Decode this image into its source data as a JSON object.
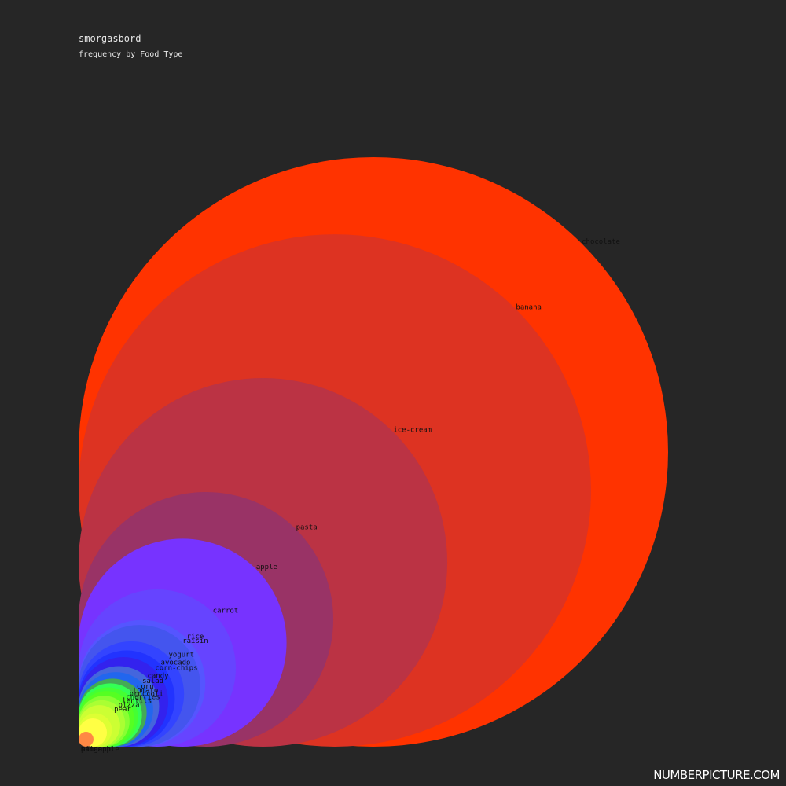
{
  "chart_data": {
    "type": "bubble",
    "title": "smorgasbord",
    "subtitle": "frequency by Food Type",
    "categories": [
      "chocolate",
      "banana",
      "ice-cream",
      "pasta",
      "apple",
      "carrot",
      "rice",
      "raisin",
      "yogurt",
      "avocado",
      "corn-chips",
      "candy",
      "salad",
      "corn",
      "tomato",
      "broccoli",
      "cherries",
      "lentils",
      "pizza",
      "pear",
      "mango",
      "spinach",
      "pineapple"
    ],
    "values": [
      562500,
      425000,
      220000,
      105000,
      70000,
      40000,
      26000,
      24000,
      18000,
      15000,
      13000,
      10500,
      9000,
      7500,
      6500,
      5700,
      5000,
      4200,
      3500,
      2800,
      1800,
      1300,
      360
    ],
    "colors": [
      "#ff3300",
      "#dd3322",
      "#bb3344",
      "#993366",
      "#7733ff",
      "#6644ff",
      "#5555ff",
      "#4455ee",
      "#3344ff",
      "#2233ff",
      "#3322ee",
      "#4466dd",
      "#2266ee",
      "#44aa55",
      "#33ff55",
      "#44ff33",
      "#55ff22",
      "#88ff33",
      "#aaff33",
      "#ccff33",
      "#ddff33",
      "#ffff44",
      "#ff8844"
    ]
  },
  "brand": "NUMBERPICTURE.COM"
}
